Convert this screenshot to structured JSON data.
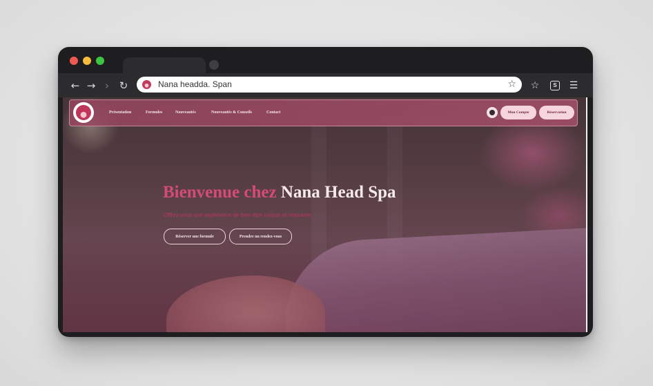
{
  "browser": {
    "url": "Nana headda. Span",
    "icons": {
      "back": "arrow-left-icon",
      "forward": "arrow-right-icon",
      "chevron": "chevron-right-icon",
      "reload": "reload-icon",
      "bookmark": "star-icon",
      "extension": "extension-icon",
      "menu": "hamburger-icon"
    }
  },
  "site": {
    "nav": {
      "links": [
        "Présentation",
        "Formules",
        "Nouveautés",
        "Nouveautés & Conseils",
        "Contact"
      ],
      "account_button": "Mon Compte",
      "book_button": "Réservation"
    },
    "hero": {
      "title_pink": "Bienvenue chez",
      "title_white": "Nana Head Spa",
      "subtitle": "Offrez-vous une expérience de bien-être unique et relaxante.",
      "primary_button": "Réserver une formule",
      "secondary_button": "Prendre un rendez-vous"
    },
    "colors": {
      "accent": "#d34c75",
      "nav_bg": "#9a4a63",
      "pill_bg": "#f7d5dd"
    }
  }
}
